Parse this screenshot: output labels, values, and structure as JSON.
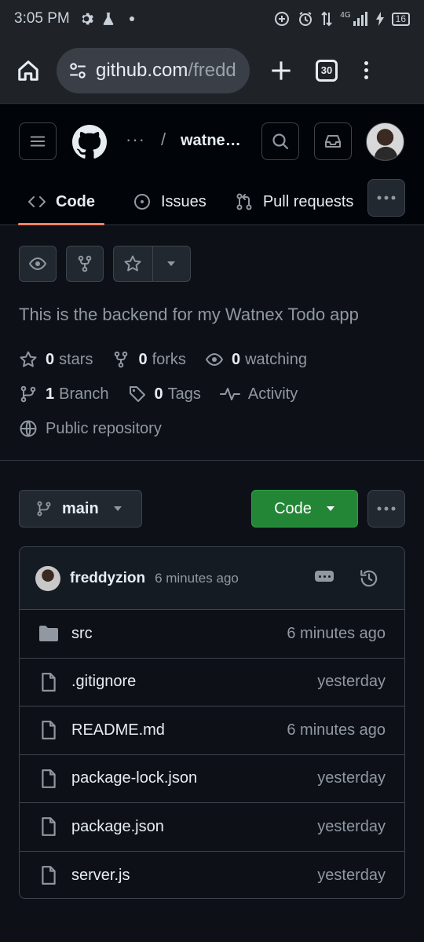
{
  "status_bar": {
    "time": "3:05 PM",
    "network": "4G",
    "battery": "16"
  },
  "browser": {
    "url_domain": "github.com",
    "url_path": "/fredd",
    "tab_count": "30"
  },
  "header": {
    "breadcrumb_ellipsis": "···",
    "breadcrumb_separator": "/",
    "repo_name": "watnex-todo"
  },
  "nav": {
    "tabs": [
      {
        "label": "Code"
      },
      {
        "label": "Issues"
      },
      {
        "label": "Pull requests"
      }
    ]
  },
  "repo": {
    "description": "This is the backend for my Watnex Todo app",
    "stars_count": "0",
    "stars_label": "stars",
    "forks_count": "0",
    "forks_label": "forks",
    "watching_count": "0",
    "watching_label": "watching",
    "branch_count": "1",
    "branch_label": "Branch",
    "tags_count": "0",
    "tags_label": "Tags",
    "activity_label": "Activity",
    "visibility_label": "Public repository"
  },
  "toolbar": {
    "branch": "main",
    "code_button": "Code"
  },
  "commit": {
    "author": "freddyzion",
    "time": "6 minutes ago"
  },
  "files": [
    {
      "name": "src",
      "type": "folder",
      "time": "6 minutes ago"
    },
    {
      "name": ".gitignore",
      "type": "file",
      "time": "yesterday"
    },
    {
      "name": "README.md",
      "type": "file",
      "time": "6 minutes ago"
    },
    {
      "name": "package-lock.json",
      "type": "file",
      "time": "yesterday"
    },
    {
      "name": "package.json",
      "type": "file",
      "time": "yesterday"
    },
    {
      "name": "server.js",
      "type": "file",
      "time": "yesterday"
    }
  ],
  "colors": {
    "accent_green": "#238636",
    "tab_underline": "#f78166",
    "background": "#0d1117"
  }
}
